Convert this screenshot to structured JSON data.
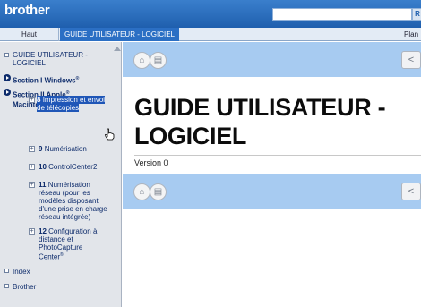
{
  "app": {
    "logo": "brother"
  },
  "search": {
    "button": "R"
  },
  "tabs": {
    "home": "Haut",
    "active": "GUIDE UTILISATEUR - LOGICIEL",
    "plan": "Plan"
  },
  "sidebar": {
    "root_line1": "GUIDE UTILISATEUR -",
    "root_line2": "LOGICIEL",
    "section1": "Section I Windows",
    "section1_sup": "®",
    "section2_line1": "Section II Apple",
    "section2_sup": "®",
    "section2_line2": "Macintosh",
    "section2_sup2": "®",
    "ch8_num": "8",
    "ch8_line1": "Impression et envoi",
    "ch8_line2": "de télécopies",
    "ch9_num": "9",
    "ch9_label": "Numérisation",
    "ch10_num": "10",
    "ch10_label": "ControlCenter2",
    "ch11_num": "11",
    "ch11_line1": "Numérisation",
    "ch11_line2": "réseau (pour les",
    "ch11_line3": "modèles disposant",
    "ch11_line4": "d'une prise en charge",
    "ch11_line5": "réseau intégrée)",
    "ch12_num": "12",
    "ch12_line1": "Configuration à",
    "ch12_line2": "distance et",
    "ch12_line3": "PhotoCapture",
    "ch12_line4": "Center",
    "ch12_sup": "®",
    "index": "Index",
    "brother": "Brother"
  },
  "content": {
    "title_line1": "GUIDE UTILISATEUR -",
    "title_line2": "LOGICIEL",
    "version": "Version 0",
    "back_glyph": "<"
  }
}
